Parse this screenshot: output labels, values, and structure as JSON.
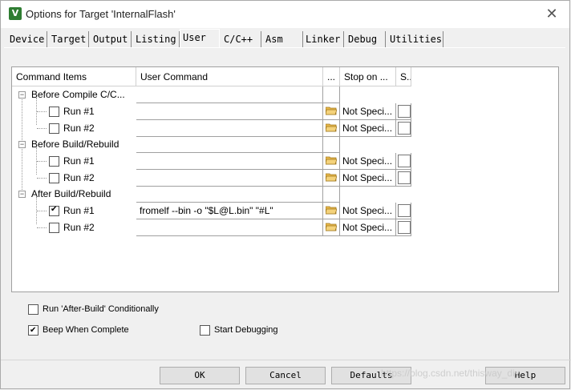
{
  "window": {
    "title": "Options for Target 'InternalFlash'",
    "close_glyph": "✕",
    "app_icon_letter": "V"
  },
  "tabs": [
    {
      "label": "Device"
    },
    {
      "label": "Target"
    },
    {
      "label": "Output"
    },
    {
      "label": "Listing"
    },
    {
      "label": "User",
      "active": true
    },
    {
      "label": "C/C++"
    },
    {
      "label": "Asm"
    },
    {
      "label": "Linker"
    },
    {
      "label": "Debug"
    },
    {
      "label": "Utilities"
    }
  ],
  "grid": {
    "headers": [
      "Command Items",
      "User Command",
      "...",
      "Stop on ...",
      "S..."
    ],
    "groups": [
      {
        "label": "Before Compile C/C...",
        "expander": "−",
        "items": [
          {
            "label": "Run #1",
            "checked": false,
            "command": "",
            "stop": "Not Speci..."
          },
          {
            "label": "Run #2",
            "checked": false,
            "command": "",
            "stop": "Not Speci..."
          }
        ]
      },
      {
        "label": "Before Build/Rebuild",
        "expander": "−",
        "items": [
          {
            "label": "Run #1",
            "checked": false,
            "command": "",
            "stop": "Not Speci..."
          },
          {
            "label": "Run #2",
            "checked": false,
            "command": "",
            "stop": "Not Speci..."
          }
        ]
      },
      {
        "label": "After Build/Rebuild",
        "expander": "−",
        "items": [
          {
            "label": "Run #1",
            "checked": true,
            "command": "fromelf --bin -o \"$L@L.bin\" \"#L\"",
            "stop": "Not Speci..."
          },
          {
            "label": "Run #2",
            "checked": false,
            "command": "",
            "stop": "Not Speci..."
          }
        ]
      }
    ]
  },
  "options": {
    "run_after_build": {
      "label": "Run 'After-Build' Conditionally",
      "checked": false
    },
    "beep": {
      "label": "Beep When Complete",
      "checked": true
    },
    "start_debugging": {
      "label": "Start Debugging",
      "checked": false
    }
  },
  "buttons": {
    "ok": "OK",
    "cancel": "Cancel",
    "defaults": "Defaults",
    "help": "Help"
  },
  "watermark": "https://blog.csdn.net/thisway_diy",
  "colors": {
    "folder": "#e8b84a",
    "app_icon": "#2f7d32"
  }
}
